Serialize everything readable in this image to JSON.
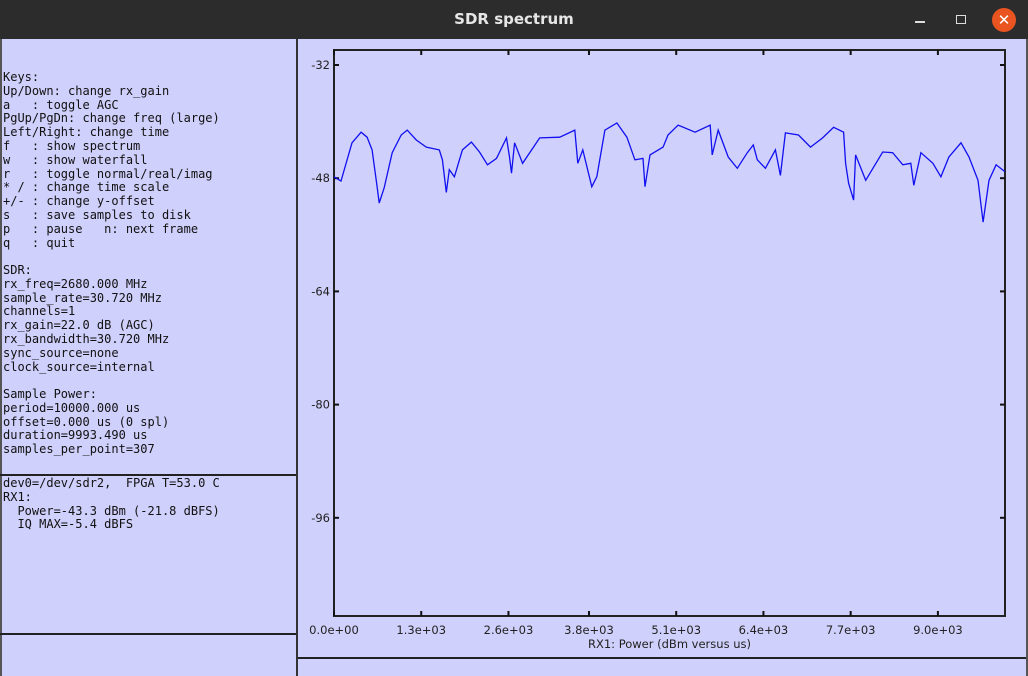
{
  "window": {
    "title": "SDR spectrum",
    "close_icon": "close-icon",
    "minimize_icon": "minimize-icon",
    "maximize_icon": "maximize-icon"
  },
  "keys": {
    "heading": "Keys:",
    "lines": [
      "Up/Down: change rx_gain",
      "a   : toggle AGC",
      "PgUp/PgDn: change freq (large)",
      "Left/Right: change time",
      "f   : show spectrum",
      "w   : show waterfall",
      "r   : toggle normal/real/imag",
      "* / : change time scale",
      "+/- : change y-offset",
      "s   : save samples to disk",
      "p   : pause   n: next frame",
      "q   : quit"
    ]
  },
  "sdr": {
    "heading": "SDR:",
    "lines": [
      "rx_freq=2680.000 MHz",
      "sample_rate=30.720 MHz",
      "channels=1",
      "rx_gain=22.0 dB (AGC)",
      "rx_bandwidth=30.720 MHz",
      "sync_source=none",
      "clock_source=internal"
    ]
  },
  "sample_power": {
    "heading": "Sample Power:",
    "lines": [
      "period=10000.000 us",
      "offset=0.000 us (0 spl)",
      "duration=9993.490 us",
      "samples_per_point=307"
    ]
  },
  "status": {
    "lines": [
      "dev0=/dev/sdr2,  FPGA T=53.0 C",
      "RX1:",
      "  Power=-43.3 dBm (-21.8 dBFS)",
      "  IQ MAX=-5.4 dBFS"
    ]
  },
  "chart_data": {
    "type": "line",
    "title": "",
    "xlabel": "RX1: Power (dBm versus us)",
    "ylabel": "",
    "xlim": [
      0,
      10000
    ],
    "ylim": [
      -110,
      -29.9
    ],
    "x_ticks": [
      0,
      1300,
      2600,
      3800,
      5100,
      6400,
      7700,
      9000
    ],
    "x_tick_labels": [
      "0.0e+00",
      "1.3e+03",
      "2.6e+03",
      "3.8e+03",
      "5.1e+03",
      "6.4e+03",
      "7.7e+03",
      "9.0e+03"
    ],
    "y_ticks": [
      -32,
      -48,
      -64,
      -80,
      -96
    ],
    "y_tick_labels": [
      "-32",
      "-48",
      "-64",
      "-80",
      "-96"
    ],
    "grid": false,
    "line_color": "#1010f0",
    "series": [
      {
        "x": [
          0,
          105,
          269,
          404,
          493,
          568,
          643,
          673,
          747,
          867,
          1002,
          1091,
          1226,
          1375,
          1570,
          1615,
          1674,
          1719,
          1794,
          1914,
          2048,
          2168,
          2287,
          2422,
          2571,
          2616,
          2646,
          2691,
          2811,
          3065,
          3364,
          3588,
          3633,
          3708,
          3842,
          3917,
          4037,
          4216,
          4365,
          4485,
          4605,
          4635,
          4709,
          4904,
          4978,
          5128,
          5382,
          5606,
          5636,
          5726,
          5875,
          6010,
          6159,
          6249,
          6309,
          6429,
          6578,
          6653,
          6728,
          6922,
          7101,
          7281,
          7445,
          7595,
          7625,
          7669,
          7744,
          7774,
          7924,
          8178,
          8327,
          8477,
          8596,
          8641,
          8746,
          8925,
          9045,
          9164,
          9344,
          9464,
          9598,
          9673,
          9762,
          9867,
          10000
        ],
        "y": [
          -47.8,
          -48.4,
          -43.0,
          -41.5,
          -42.2,
          -44.0,
          -49.2,
          -51.5,
          -49.4,
          -44.4,
          -41.9,
          -41.2,
          -42.6,
          -43.6,
          -44.0,
          -45.4,
          -50.0,
          -46.8,
          -47.8,
          -44.0,
          -42.9,
          -44.3,
          -46.1,
          -45.2,
          -42.3,
          -45.0,
          -47.3,
          -43.0,
          -45.9,
          -42.3,
          -42.2,
          -41.2,
          -45.9,
          -44.0,
          -49.2,
          -47.8,
          -41.2,
          -40.2,
          -42.2,
          -45.4,
          -45.2,
          -49.2,
          -44.7,
          -43.6,
          -41.9,
          -40.5,
          -41.5,
          -40.5,
          -44.7,
          -41.2,
          -45.0,
          -46.6,
          -44.4,
          -43.3,
          -45.4,
          -46.6,
          -44.0,
          -47.6,
          -41.6,
          -41.9,
          -43.6,
          -42.3,
          -40.8,
          -41.5,
          -45.9,
          -48.7,
          -51.1,
          -44.7,
          -48.3,
          -44.3,
          -44.4,
          -46.1,
          -45.9,
          -49.0,
          -44.4,
          -45.9,
          -47.8,
          -45.0,
          -43.0,
          -45.0,
          -48.3,
          -54.2,
          -48.3,
          -46.1,
          -47.1
        ]
      }
    ]
  }
}
